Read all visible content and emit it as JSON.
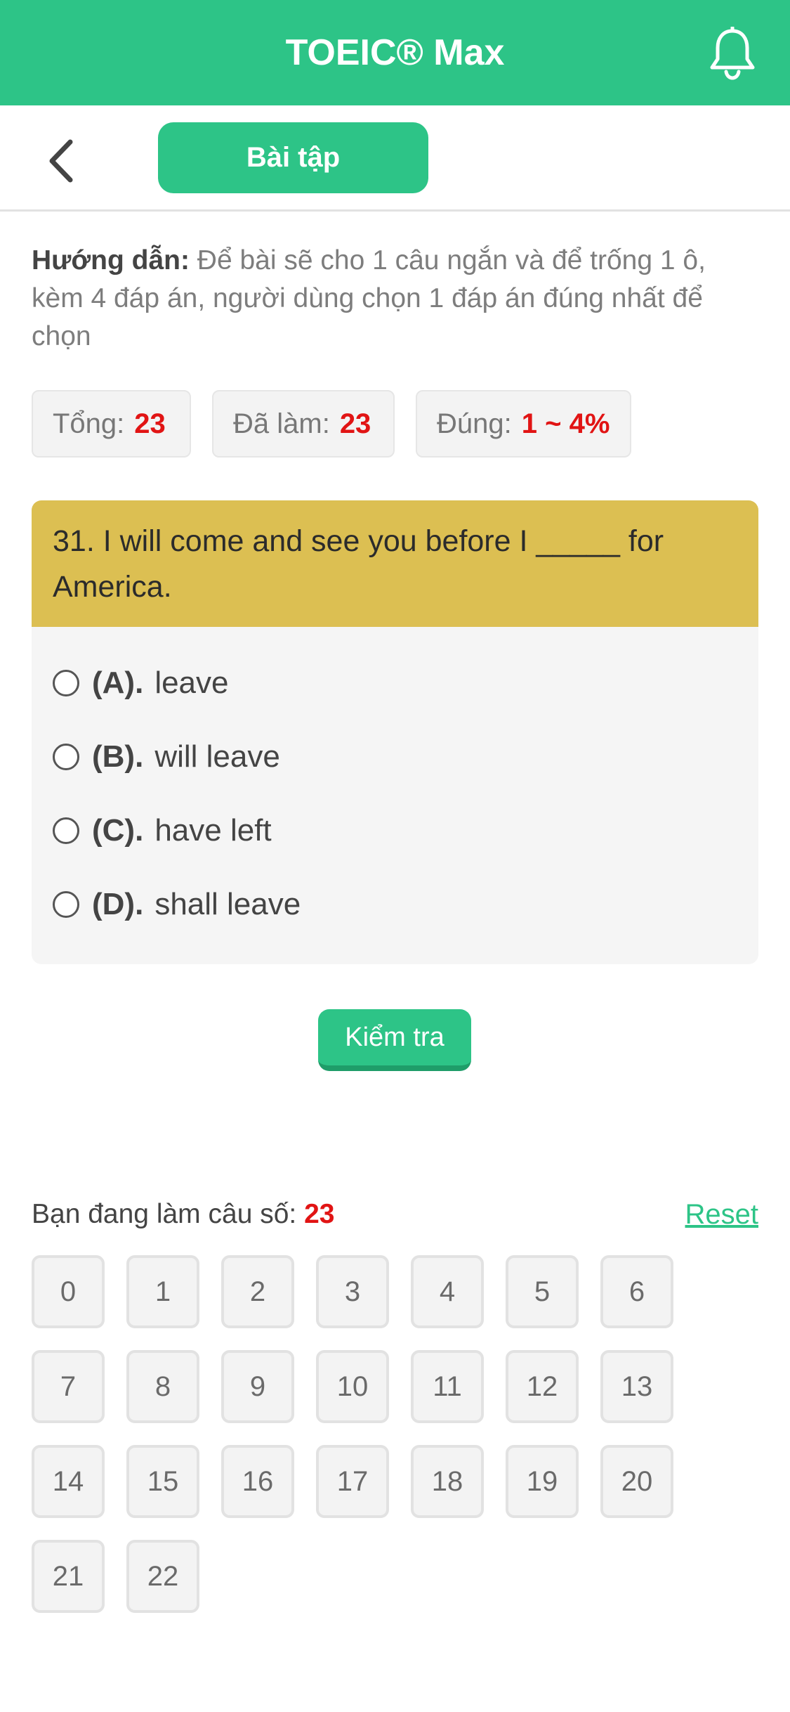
{
  "app": {
    "title": "TOEIC® Max",
    "notification_icon": "bell-icon",
    "accent_color": "#2dc487"
  },
  "subheader": {
    "back_icon": "chevron-left-icon",
    "tab_label": "Bài tập"
  },
  "instructions": {
    "label": "Hướng dẫn:",
    "text": "Để bài sẽ cho 1 câu ngắn và để trống 1 ô, kèm 4 đáp án, người dùng chọn 1 đáp án đúng nhất để chọn"
  },
  "stats": {
    "total_label": "Tổng:",
    "total_value": "23",
    "done_label": "Đã làm:",
    "done_value": "23",
    "correct_label": "Đúng:",
    "correct_value": "1 ~ 4%"
  },
  "question": {
    "text": "31. I will come and see you before I _____ for America.",
    "header_color": "#dcbf52",
    "options": [
      {
        "letter": "(A).",
        "text": "leave"
      },
      {
        "letter": "(B).",
        "text": "will leave"
      },
      {
        "letter": "(C).",
        "text": "have left"
      },
      {
        "letter": "(D).",
        "text": "shall leave"
      }
    ]
  },
  "check_button_label": "Kiểm tra",
  "progress": {
    "current_label": "Bạn đang làm câu số:",
    "current_value": "23",
    "reset_label": "Reset",
    "numbers": [
      "0",
      "1",
      "2",
      "3",
      "4",
      "5",
      "6",
      "7",
      "8",
      "9",
      "10",
      "11",
      "12",
      "13",
      "14",
      "15",
      "16",
      "17",
      "18",
      "19",
      "20",
      "21",
      "22"
    ]
  }
}
